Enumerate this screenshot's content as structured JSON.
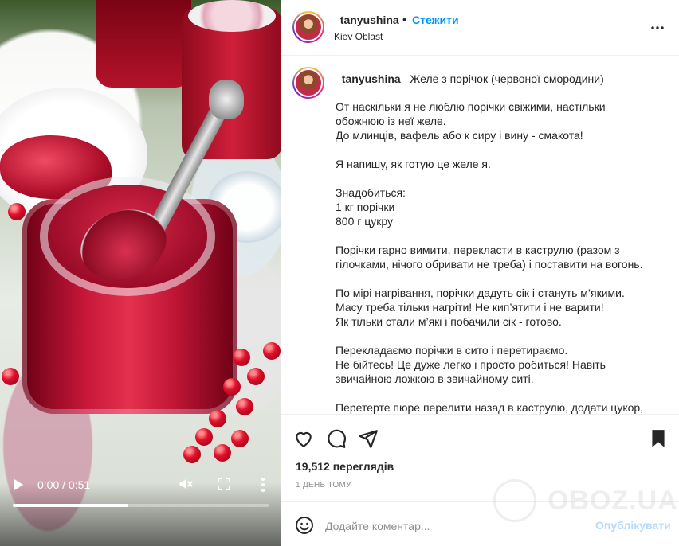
{
  "video": {
    "time": "0:00 / 0:51",
    "progress": 0.45,
    "icons": {
      "play": "play-icon",
      "mute": "volume-muted-icon",
      "fullscreen": "fullscreen-icon",
      "more": "more-vertical-icon"
    }
  },
  "header": {
    "username": "_tanyushina_",
    "separator": "•",
    "follow_label": "Стежити",
    "location": "Kiev Oblast",
    "more_icon": "more-horizontal-icon"
  },
  "caption": {
    "username": "_tanyushina_",
    "title": "Желе з порічок (червоної смородини)",
    "paragraphs": [
      [
        "От наскільки я не люблю порічки свіжими, настільки",
        "обожнюю із неї желе.",
        "До млинців, вафель або к сиру і вину - смакота!"
      ],
      [
        "Я напишу, як готую це желе я."
      ],
      [
        "Знадобиться:",
        "1 кг порічки",
        "800 г цукру"
      ],
      [
        "Порічки гарно вимити, перекласти в каструлю (разом з",
        "гілочками, нічого обривати не треба) і поставити на вогонь."
      ],
      [
        "По мірі нагрівання, порічки дадуть сік і стануть м’якими.",
        "Масу треба тільки нагріти! Не кип’ятити і не варити!",
        "Як тільки стали м’які і побачили сік - готово."
      ],
      [
        "Перекладаємо порічки в сито і перетираємо.",
        "Не бійтесь! Це дуже легко і просто робиться! Навіть",
        "звичайною ложкою в звичайному ситі."
      ],
      [
        "Перетерте пюре перелити назад в каструлю, додати цукор,"
      ]
    ]
  },
  "actions": {
    "like_icon": "heart-icon",
    "comment_icon": "comment-icon",
    "share_icon": "send-icon",
    "save_icon": "bookmark-icon"
  },
  "stats": {
    "views": "19,512 переглядів",
    "date": "1 ДЕНЬ ТОМУ"
  },
  "comment": {
    "emoji_icon": "emoji-icon",
    "placeholder": "Додайте коментар...",
    "publish_label": "Опублікувати"
  },
  "watermark": {
    "text": "OBOZ.UA"
  },
  "colors": {
    "accent": "#0095f6",
    "publish_disabled": "#b3dbff",
    "text": "#262626",
    "muted": "#8e8e8e"
  }
}
